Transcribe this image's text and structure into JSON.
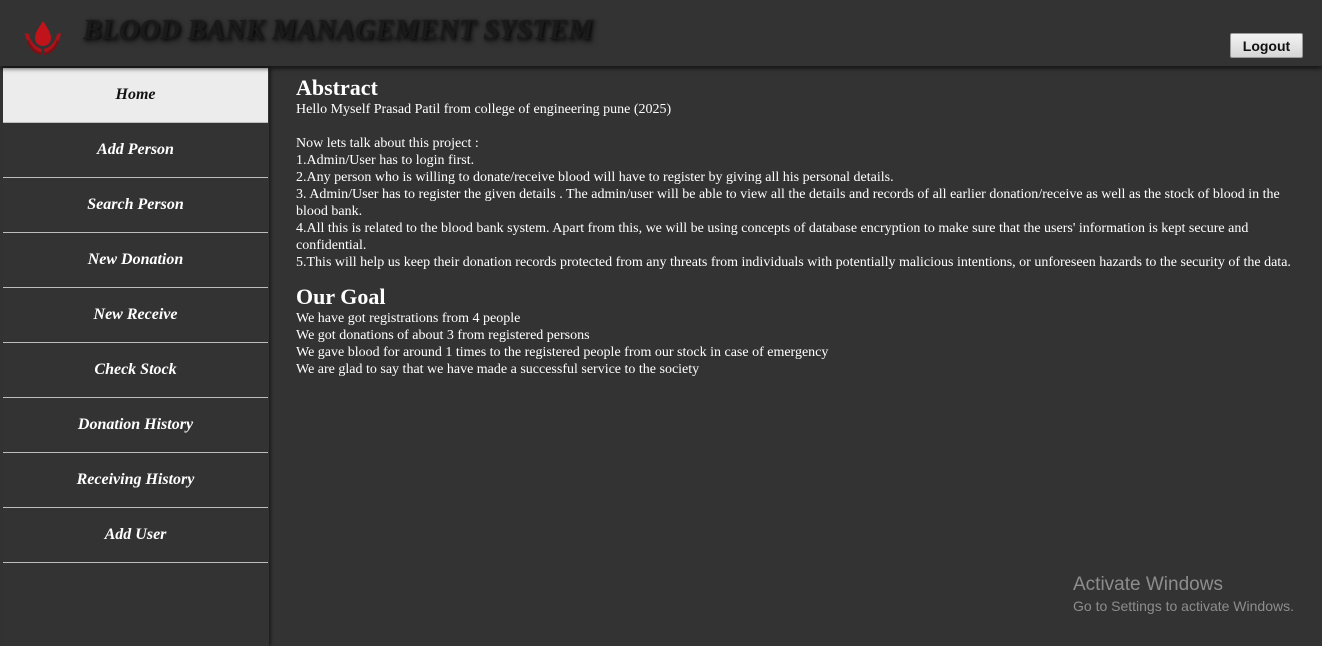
{
  "header": {
    "title": "BLOOD BANK MANAGEMENT SYSTEM",
    "logout_label": "Logout",
    "logo_icon": "blood-drop-hands-icon",
    "colors": {
      "logo_red": "#c0141a",
      "background": "#333333"
    }
  },
  "sidebar": {
    "items": [
      {
        "label": "Home",
        "active": true
      },
      {
        "label": "Add Person"
      },
      {
        "label": "Search Person"
      },
      {
        "label": "New Donation"
      },
      {
        "label": "New Receive"
      },
      {
        "label": "Check Stock"
      },
      {
        "label": "Donation History"
      },
      {
        "label": "Receiving History"
      },
      {
        "label": "Add User"
      }
    ]
  },
  "main": {
    "abstract": {
      "heading": "Abstract",
      "intro": "Hello Myself Prasad Patil from college of engineering pune (2025)",
      "lead": "Now lets talk about this project :",
      "points": [
        "1.Admin/User has to login first.",
        "2.Any person who is willing to donate/receive blood will have to register by giving all his personal details.",
        "3. Admin/User has to register the given details . The admin/user will be able to view all the details and records of all earlier donation/receive as well as the stock of blood in the blood bank.",
        "4.All this is related to the blood bank system. Apart from this, we will be using concepts of database encryption to make sure that the users' information is kept secure and confidential.",
        "5.This will help us keep their donation records protected from any threats from individuals with potentially malicious intentions, or unforeseen hazards to the security of the data."
      ]
    },
    "goal": {
      "heading": "Our Goal",
      "lines": [
        "We have got registrations from 4 people",
        "We got donations of about 3 from registered persons",
        "We gave blood for around 1 times to the registered people from our stock in case of emergency",
        "We are glad to say that we have made a successful service to the society"
      ]
    }
  },
  "watermark": {
    "title": "Activate Windows",
    "subtitle": "Go to Settings to activate Windows."
  }
}
